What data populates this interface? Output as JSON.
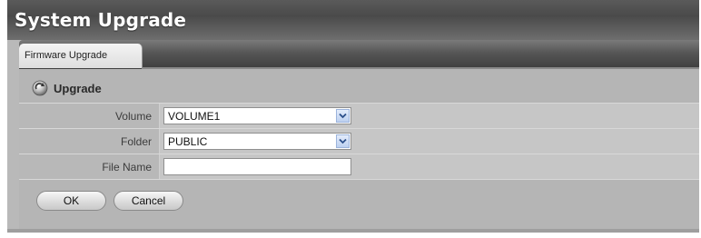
{
  "window": {
    "title": "System Upgrade"
  },
  "tabs": [
    {
      "label": "Firmware Upgrade",
      "active": true
    }
  ],
  "section": {
    "title": "Upgrade",
    "icon": "upgrade-icon"
  },
  "form": {
    "volume": {
      "label": "Volume",
      "value": "VOLUME1"
    },
    "folder": {
      "label": "Folder",
      "value": "PUBLIC"
    },
    "file_name": {
      "label": "File Name",
      "value": "",
      "placeholder": ""
    }
  },
  "buttons": {
    "ok": "OK",
    "cancel": "Cancel"
  },
  "colors": {
    "title_bar": "#4a4a4a",
    "tab_bar": "#555555",
    "content_bg": "#b5b5b5",
    "dropdown_arrow": "#bcd0f0"
  }
}
